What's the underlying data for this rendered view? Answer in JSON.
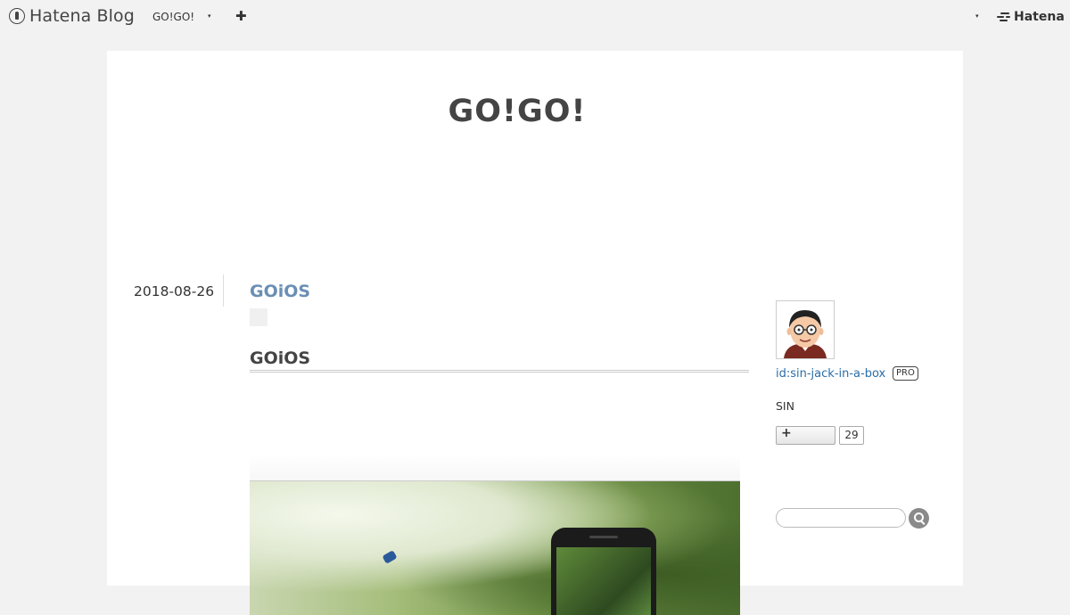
{
  "topbar": {
    "logo_text": "Hatena Blog",
    "blog_name": "GO!GO!",
    "caret": "▾",
    "add_label": "✚",
    "hatena_text": "Hatena"
  },
  "blog": {
    "title": "GO!GO!"
  },
  "entry": {
    "date": "2018-08-26",
    "title": "GOiOS",
    "heading": "GOiOS"
  },
  "sidebar": {
    "profile_id": "id:sin-jack-in-a-box",
    "pro_badge": "PRO",
    "profile_name": "SIN",
    "subscribe_icon": "plus-icon",
    "subscribe_count": "29",
    "search_placeholder": ""
  },
  "colors": {
    "accent_link": "#2a6ea8",
    "entry_title": "#6b8fb5",
    "page_bg": "#f2f2f2"
  }
}
